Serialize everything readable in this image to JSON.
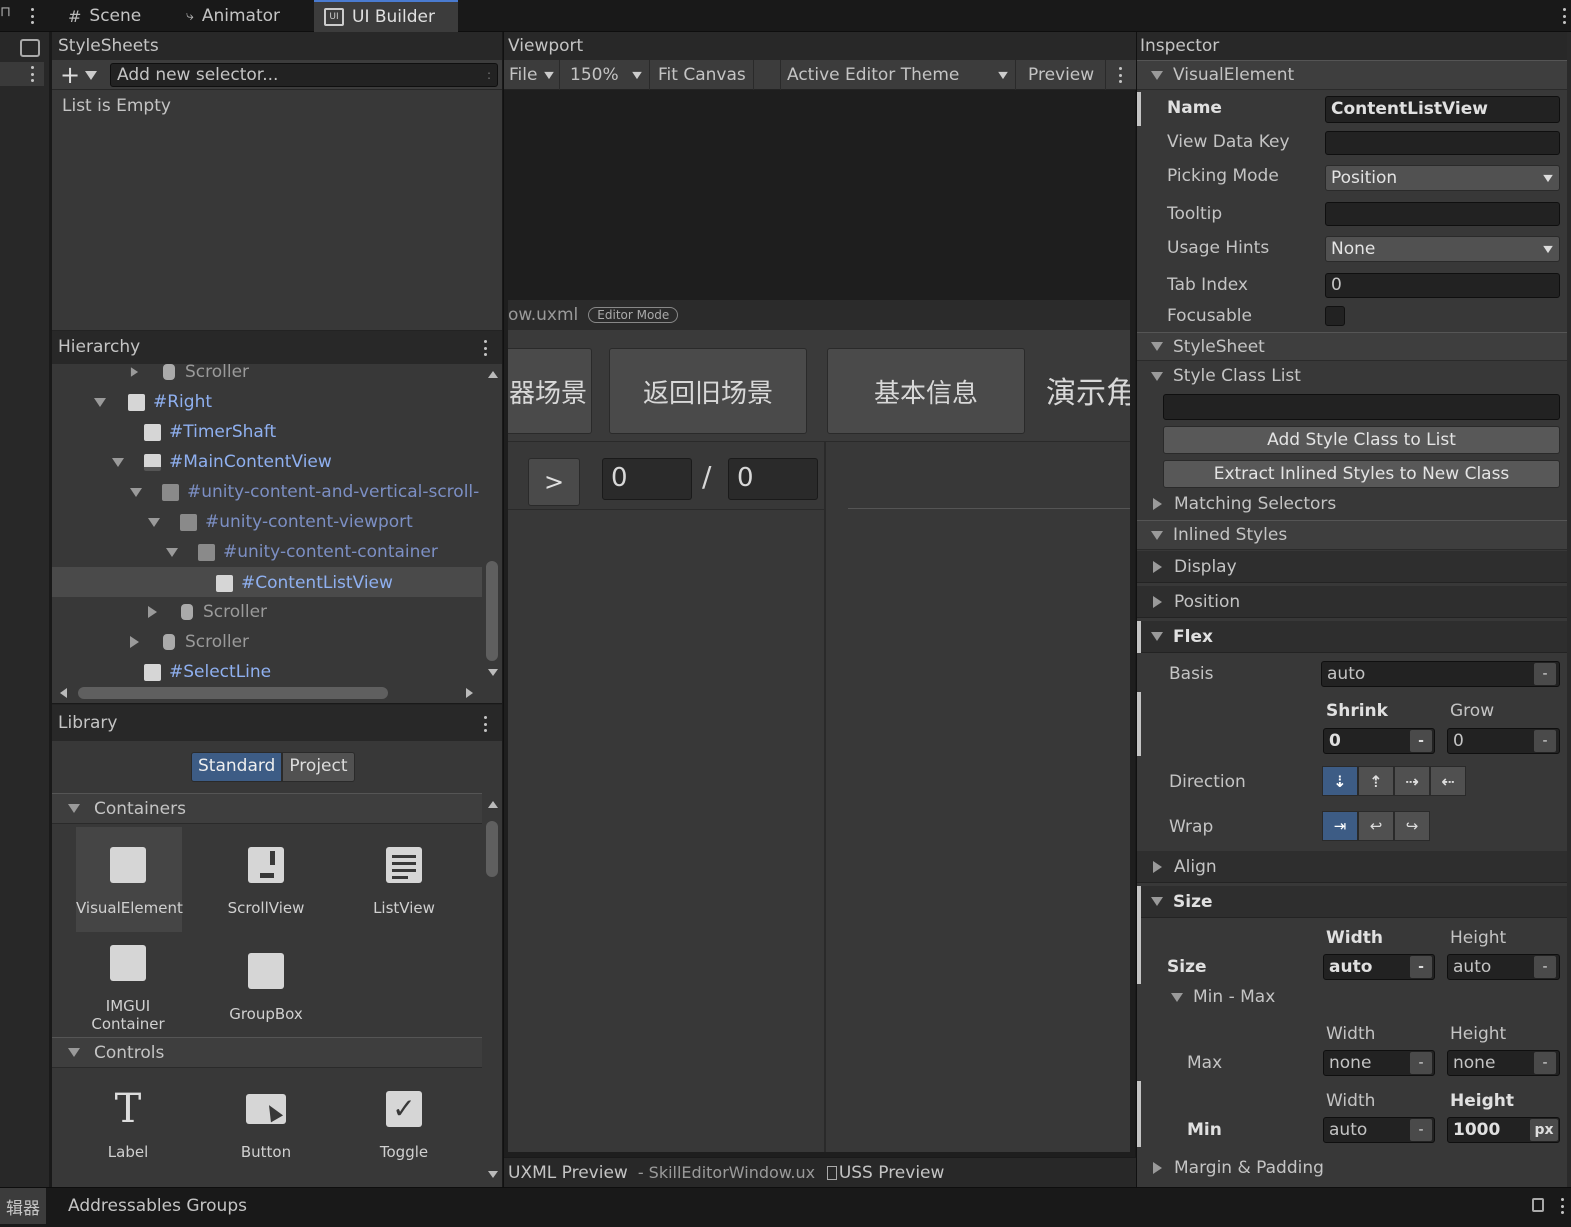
{
  "tabs": {
    "scene": "Scene",
    "animator": "Animator",
    "ui_builder": "UI Builder"
  },
  "stylesheets": {
    "title": "StyleSheets",
    "selector_placeholder": "Add new selector...",
    "empty": "List is Empty"
  },
  "hierarchy": {
    "title": "Hierarchy",
    "items": [
      {
        "label": "Scroller"
      },
      {
        "label": "#Right"
      },
      {
        "label": "#TimerShaft"
      },
      {
        "label": "#MainContentView"
      },
      {
        "label": "#unity-content-and-vertical-scroll-"
      },
      {
        "label": "#unity-content-viewport"
      },
      {
        "label": "#unity-content-container"
      },
      {
        "label": "#ContentListView"
      },
      {
        "label": "Scroller"
      },
      {
        "label": "Scroller"
      },
      {
        "label": "#SelectLine"
      }
    ]
  },
  "library": {
    "title": "Library",
    "tab_standard": "Standard",
    "tab_project": "Project",
    "containers_label": "Containers",
    "controls_label": "Controls",
    "containers": [
      "VisualElement",
      "ScrollView",
      "ListView",
      "IMGUI\nContainer",
      "GroupBox"
    ],
    "controls": [
      "Label",
      "Button",
      "Toggle"
    ]
  },
  "viewport": {
    "title": "Viewport",
    "file": "File",
    "zoom": "150%",
    "fit_canvas": "Fit Canvas",
    "theme": "Active Editor Theme",
    "preview": "Preview",
    "doc_name": "ow.uxml",
    "editor_mode": "Editor Mode",
    "canvas_buttons": [
      "器场景",
      "返回旧场景",
      "基本信息",
      "演示角"
    ],
    "pager": {
      "next": ">",
      "current": "0",
      "sep": "/",
      "total": "0"
    },
    "uxml_preview": "UXML Preview",
    "uxml_file": "- SkillEditorWindow.ux",
    "uss_preview": "USS Preview"
  },
  "inspector": {
    "title": "Inspector",
    "visual_element": "VisualElement",
    "name_label": "Name",
    "name_value": "ContentListView",
    "view_data_key": "View Data Key",
    "picking_mode": "Picking Mode",
    "picking_mode_value": "Position",
    "tooltip": "Tooltip",
    "usage_hints": "Usage Hints",
    "usage_hints_value": "None",
    "tab_index": "Tab Index",
    "tab_index_value": "0",
    "focusable": "Focusable",
    "stylesheet": "StyleSheet",
    "style_class_list": "Style Class List",
    "add_style_class": "Add Style Class to List",
    "extract_inlined": "Extract Inlined Styles to New Class",
    "matching_selectors": "Matching Selectors",
    "inlined_styles": "Inlined Styles",
    "display": "Display",
    "position": "Position",
    "flex": "Flex",
    "basis": "Basis",
    "basis_value": "auto",
    "shrink": "Shrink",
    "grow": "Grow",
    "shrink_value": "0",
    "grow_value": "0",
    "direction": "Direction",
    "wrap": "Wrap",
    "align": "Align",
    "size": "Size",
    "width": "Width",
    "height": "Height",
    "size_label": "Size",
    "size_width": "auto",
    "size_height": "auto",
    "min_max": "Min - Max",
    "max": "Max",
    "max_width": "none",
    "max_height": "none",
    "min": "Min",
    "min_width": "auto",
    "min_height": "1000",
    "px": "px",
    "margin_padding": "Margin & Padding",
    "minus": "-"
  },
  "bottom_bar": {
    "left_text": "辑器",
    "addressables": "Addressables Groups"
  }
}
